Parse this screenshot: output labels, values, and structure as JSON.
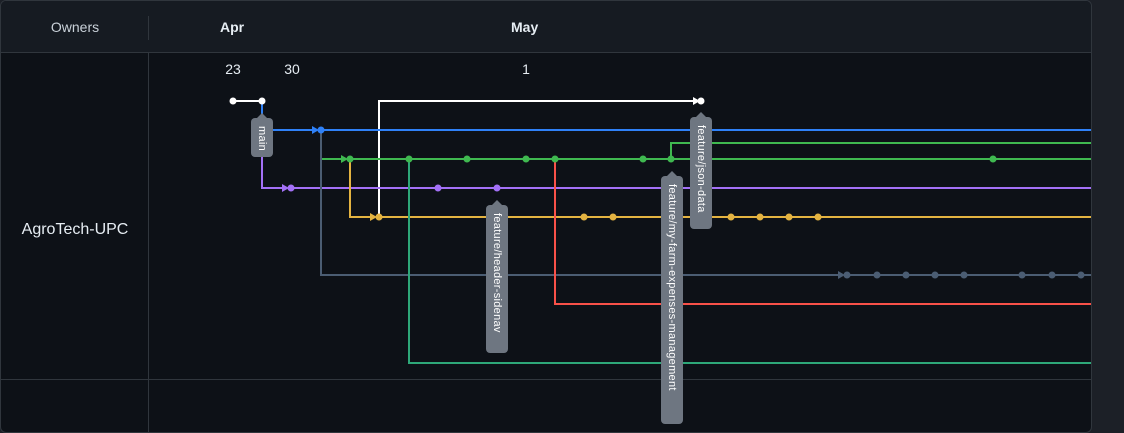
{
  "header": {
    "owners_label": "Owners"
  },
  "owner": {
    "name": "AgroTech-UPC"
  },
  "timeline": {
    "months": [
      "Apr",
      "May"
    ],
    "days": [
      "23",
      "30",
      "1"
    ]
  },
  "branches": {
    "main": "main",
    "header_sidenav": "feature/header-sidenav",
    "my_farm_expenses": "feature/my-farm-expenses-management",
    "json_data": "feature/json-data"
  },
  "colors": {
    "white": "#ffffff",
    "blue": "#2f81f7",
    "green": "#3fb950",
    "purple": "#a371f7",
    "yellow": "#e3b341",
    "slate": "#4b5d73",
    "red": "#f85149",
    "teal": "#2ea879",
    "label_bg": "#6e7681"
  }
}
